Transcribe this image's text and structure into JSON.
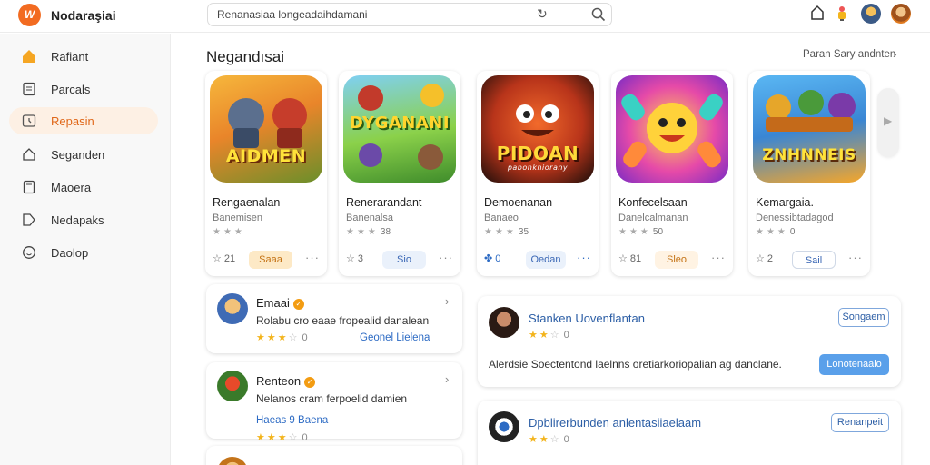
{
  "header": {
    "app_title": "Nodaraşiai",
    "search_value": "Renanasiaa longeadaihdamani",
    "icons": [
      "logo-icon",
      "refresh-icon",
      "search-icon",
      "home-icon",
      "notification-icon"
    ]
  },
  "sidebar": {
    "items": [
      {
        "label": "Rafiant",
        "icon": "home-icon",
        "active": false
      },
      {
        "label": "Parcals",
        "icon": "document-icon",
        "active": false
      },
      {
        "label": "Repasin",
        "icon": "clock-icon",
        "active": true
      },
      {
        "label": "Seganden",
        "icon": "house-icon",
        "active": false
      },
      {
        "label": "Maoera",
        "icon": "book-icon",
        "active": false
      },
      {
        "label": "Nedapaks",
        "icon": "tag-icon",
        "active": false
      },
      {
        "label": "Daolop",
        "icon": "smile-icon",
        "active": false
      }
    ]
  },
  "main": {
    "section_title": "Negandısai",
    "see_more": "Paran Sary andnten",
    "games": [
      {
        "art_text": "AIDMEN",
        "name": "Rengaenalan",
        "developer": "Banemisen",
        "rating": "21",
        "stars_count": "",
        "get_label": "Saaa",
        "get_style": "orange",
        "share_count": "21"
      },
      {
        "art_text": "DYGANANI",
        "name": "Renerarandant",
        "developer": "Banenalsa",
        "rating": "",
        "stars_count": "38",
        "get_label": "Sio",
        "get_style": "blue",
        "share_count": "3"
      },
      {
        "art_text": "PIDOAN",
        "art_sub": "pabonkniorany",
        "name": "Demoenanan",
        "developer": "Banaeo",
        "rating": "",
        "stars_count": "35",
        "get_label": "Oedan",
        "get_style": "blue",
        "share_count": "0"
      },
      {
        "art_text": "",
        "name": "Konfecelsaan",
        "developer": "Danelcalmanan",
        "rating": "",
        "stars_count": "50",
        "get_label": "Sleo",
        "get_style": "orange",
        "share_count": "81"
      },
      {
        "art_text": "ZNHNNEIS",
        "name": "Kemargaia.",
        "developer": "Denessibtadagod",
        "rating": "",
        "stars_count": "0",
        "get_label": "Sail",
        "get_style": "blue",
        "share_count": "2"
      }
    ]
  },
  "reviews_left": [
    {
      "name": "Emaai",
      "verified": true,
      "text": "Rolabu cro eaae fropealid danalean",
      "stars": 3,
      "count": "0",
      "link": "Geonel Lielena"
    },
    {
      "name": "Renteon",
      "verified": true,
      "text": "Nelanos cram ferpoelid damien",
      "stars": 3,
      "count": "0",
      "link": "Haeas 9 Baena"
    }
  ],
  "reviews_right": [
    {
      "name": "Stanken Uovenflantan",
      "stars": 2,
      "count": "0",
      "button": "Songaem",
      "text": "Alerdsie Soectentond laelnns oretiarkoriopalian ag danclane.",
      "primary_button": "Lonotenaaio"
    },
    {
      "name": "Dpblirerbunden anlentasiiaelaam",
      "stars": 2,
      "count": "0",
      "button": "Renanpeit"
    }
  ],
  "colors": {
    "accent": "#f26b21",
    "sidebar_active_bg": "#fdf0e4",
    "primary_blue": "#5aa0ea",
    "star": "#f3b41c"
  }
}
